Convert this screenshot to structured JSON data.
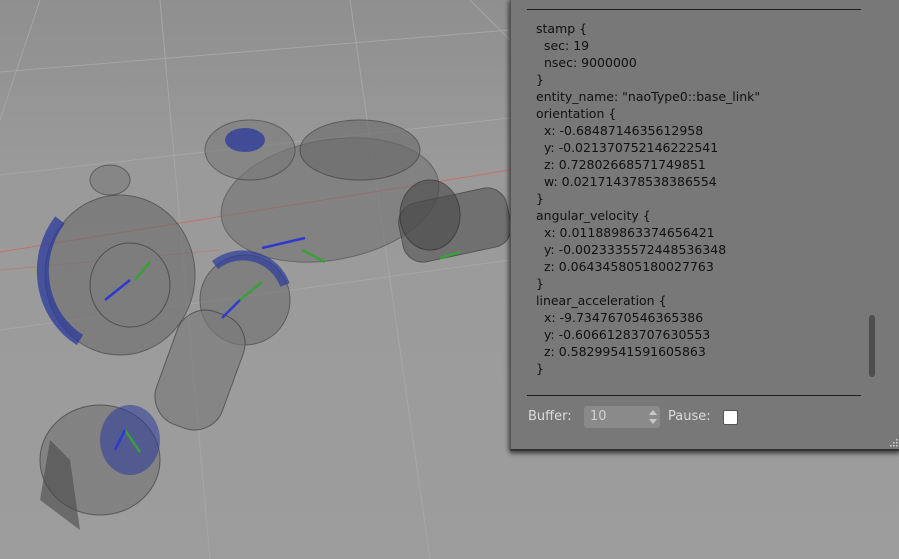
{
  "topic_echo": {
    "lines": [
      "stamp {",
      "  sec: 19",
      "  nsec: 9000000",
      "}",
      "entity_name: \"naoType0::base_link\"",
      "orientation {",
      "  x: -0.6848714635612958",
      "  y: -0.021370752146222541",
      "  z: 0.72802668571749851",
      "  w: 0.021714378538386554",
      "}",
      "angular_velocity {",
      "  x: 0.011889863374656421",
      "  y: -0.0023335572448536348",
      "  z: 0.064345805180027763",
      "}",
      "linear_acceleration {",
      "  x: -9.7347670546365386",
      "  y: -0.60661283707630553",
      "  z: 0.58299541591605863",
      "}"
    ]
  },
  "controls": {
    "buffer_label": "Buffer:",
    "buffer_value": "10",
    "pause_label": "Pause:",
    "pause_checked": false
  },
  "colors": {
    "panel_bg": "#787878",
    "scene_bg": "#9a9a9a",
    "robot_accent": "#2b3a9c"
  },
  "icons": [
    "spin-up-icon",
    "spin-down-icon",
    "resize-grip-icon"
  ]
}
